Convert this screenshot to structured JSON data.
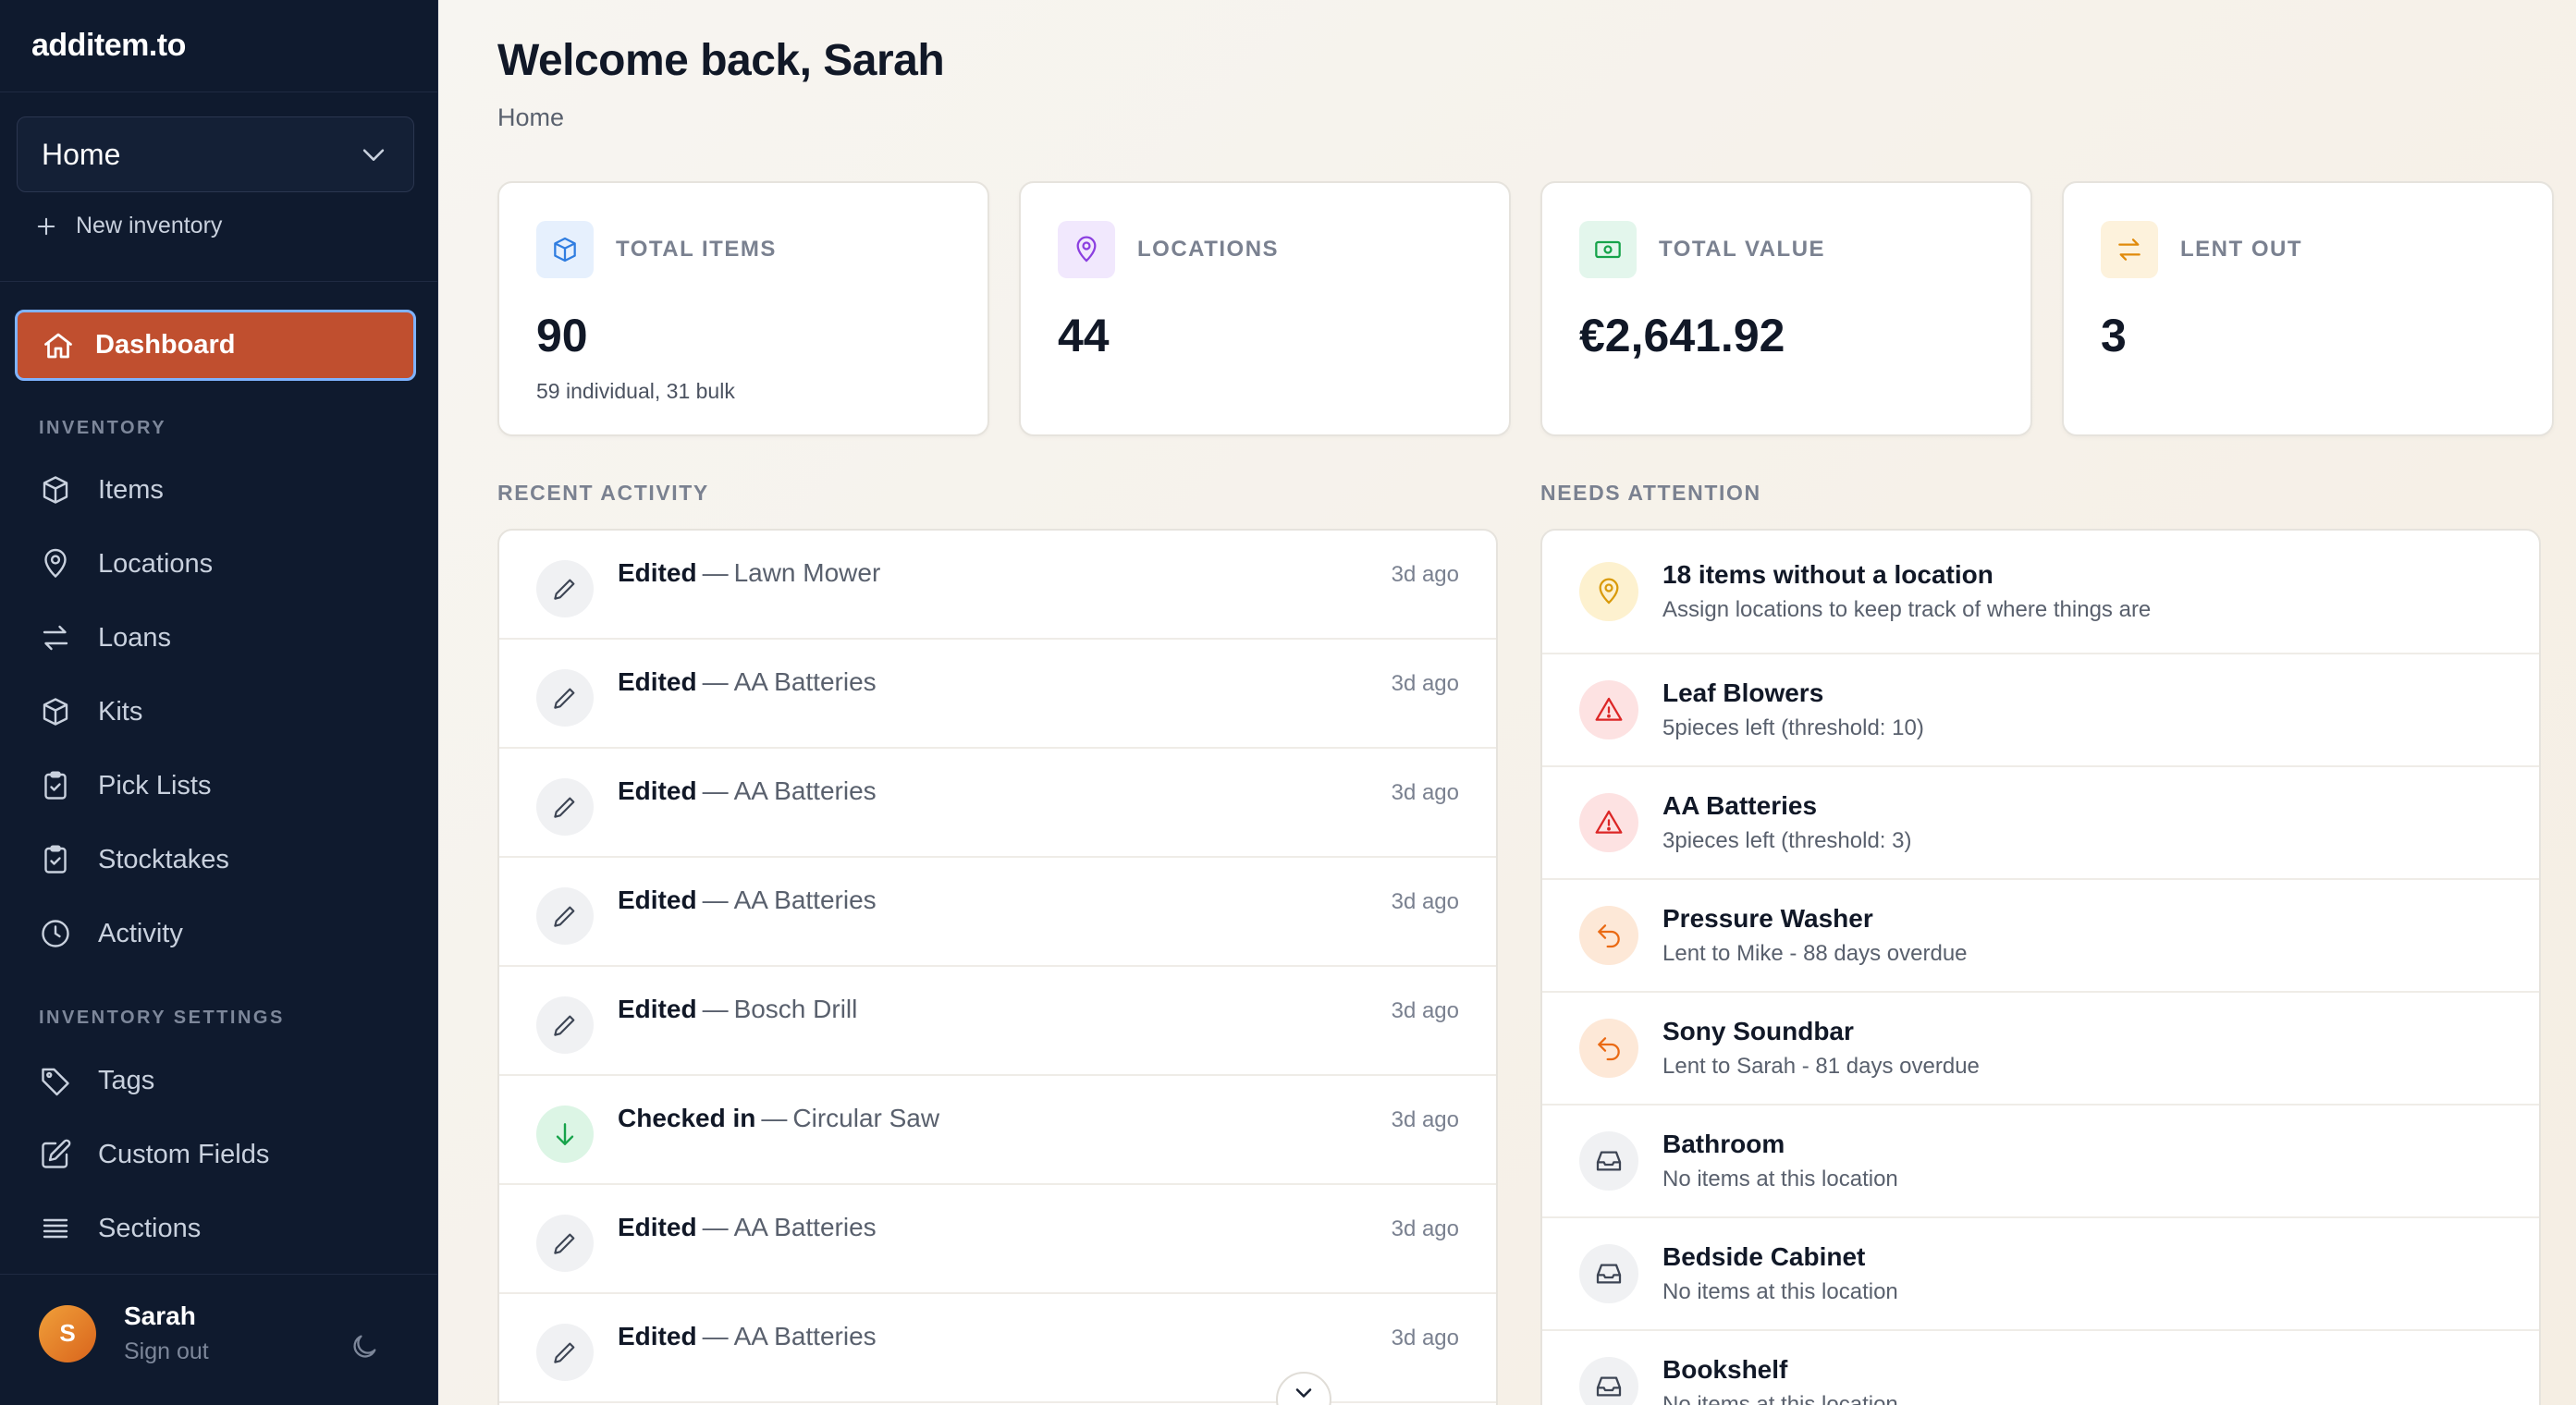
{
  "brand": "additem.to",
  "inventory_select": {
    "value": "Home"
  },
  "new_inventory_label": "New inventory",
  "nav": {
    "dashboard": "Dashboard",
    "section_inventory": "INVENTORY",
    "items": "Items",
    "locations": "Locations",
    "loans": "Loans",
    "kits": "Kits",
    "pick_lists": "Pick Lists",
    "stocktakes": "Stocktakes",
    "activity": "Activity",
    "section_settings": "INVENTORY SETTINGS",
    "tags": "Tags",
    "custom_fields": "Custom Fields",
    "sections": "Sections"
  },
  "user": {
    "initial": "S",
    "name": "Sarah",
    "sign_out": "Sign out"
  },
  "header": {
    "title": "Welcome back, Sarah",
    "breadcrumb": "Home"
  },
  "stats": [
    {
      "label": "TOTAL ITEMS",
      "value": "90",
      "sub": "59 individual, 31 bulk"
    },
    {
      "label": "LOCATIONS",
      "value": "44",
      "sub": ""
    },
    {
      "label": "TOTAL VALUE",
      "value": "€2,641.92",
      "sub": ""
    },
    {
      "label": "LENT OUT",
      "value": "3",
      "sub": ""
    }
  ],
  "recent_activity": {
    "label": "RECENT ACTIVITY",
    "rows": [
      {
        "verb": "Edited",
        "dash": "—",
        "item": "Lawn Mower",
        "time": "3d ago"
      },
      {
        "verb": "Edited",
        "dash": "—",
        "item": "AA Batteries",
        "time": "3d ago"
      },
      {
        "verb": "Edited",
        "dash": "—",
        "item": "AA Batteries",
        "time": "3d ago"
      },
      {
        "verb": "Edited",
        "dash": "—",
        "item": "AA Batteries",
        "time": "3d ago"
      },
      {
        "verb": "Edited",
        "dash": "—",
        "item": "Bosch Drill",
        "time": "3d ago"
      },
      {
        "verb": "Checked in",
        "dash": "—",
        "item": "Circular Saw",
        "time": "3d ago"
      },
      {
        "verb": "Edited",
        "dash": "—",
        "item": "AA Batteries",
        "time": "3d ago"
      },
      {
        "verb": "Edited",
        "dash": "—",
        "item": "AA Batteries",
        "time": "3d ago"
      }
    ]
  },
  "needs_attention": {
    "label": "NEEDS ATTENTION",
    "rows": [
      {
        "title": "18 items without a location",
        "sub": "Assign locations to keep track of where things are"
      },
      {
        "title": "Leaf Blowers",
        "sub": "5pieces left (threshold: 10)"
      },
      {
        "title": "AA Batteries",
        "sub": "3pieces left (threshold: 3)"
      },
      {
        "title": "Pressure Washer",
        "sub": "Lent to Mike - 88 days overdue"
      },
      {
        "title": "Sony Soundbar",
        "sub": "Lent to Sarah - 81 days overdue"
      },
      {
        "title": "Bathroom",
        "sub": "No items at this location"
      },
      {
        "title": "Bedside Cabinet",
        "sub": "No items at this location"
      },
      {
        "title": "Bookshelf",
        "sub": "No items at this location"
      }
    ]
  },
  "colors": {
    "sidebar_bg": "#0f1a2e",
    "accent": "#c04f2f",
    "focus_ring": "#7fb3ff",
    "warning": "#d99a0a",
    "danger": "#dc2626",
    "overdue": "#ea6a14",
    "success": "#16a34a"
  }
}
